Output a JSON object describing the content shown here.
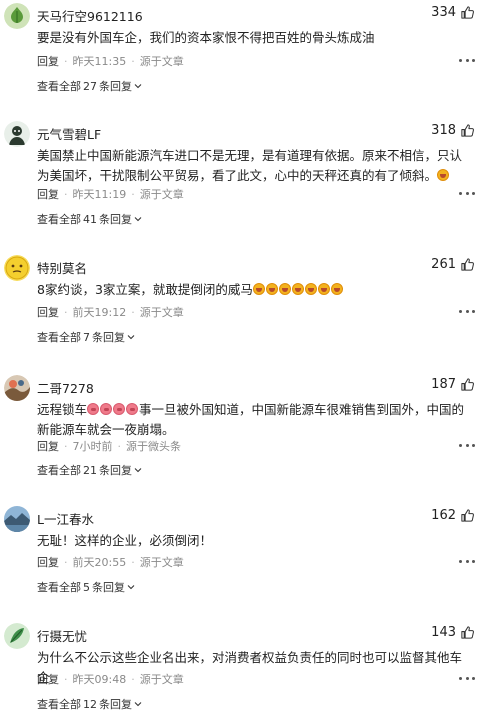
{
  "actions": {
    "reply": "回复",
    "source_prefix": "源于",
    "view_all_prefix": "查看全部",
    "view_all_suffix": "条回复"
  },
  "comments": [
    {
      "username": "天马行空9612116",
      "likes": "334",
      "text": "要是没有外国车企，我们的资本家恨不得把百姓的骨头炼成油",
      "time": "昨天11:35",
      "source": "源于文章",
      "reply_count": "27"
    },
    {
      "username": "元气雪碧LF",
      "likes": "318",
      "text": "美国禁止中国新能源汽车进口不是无理，是有道理有依据。原来不相信，只认为美国坏，干扰限制公平贸易，看了此文，心中的天秤还真的有了倾斜。",
      "time": "昨天11:19",
      "source": "源于文章",
      "reply_count": "41"
    },
    {
      "username": "特别莫名",
      "likes": "261",
      "text": "8家约谈，3家立案，就敢提倒闭的威马",
      "time": "前天19:12",
      "source": "源于文章",
      "reply_count": "7"
    },
    {
      "username": "二哥7278",
      "likes": "187",
      "text_pre": "远程锁车",
      "text": "事一旦被外国知道，中国新能源车很难销售到国外，中国的新能源车就会一夜崩塌。",
      "time": "7小时前",
      "source": "源于微头条",
      "reply_count": "21"
    },
    {
      "username": "L一江春水",
      "likes": "162",
      "text": "无耻！这样的企业，必须倒闭！",
      "time": "前天20:55",
      "source": "源于文章",
      "reply_count": "5"
    },
    {
      "username": "行摄无忧",
      "likes": "143",
      "text": "为什么不公示这些企业名出来，对消费者权益负责任的同时也可以监督其他车企",
      "time": "昨天09:48",
      "source": "源于文章",
      "reply_count": "12"
    }
  ]
}
